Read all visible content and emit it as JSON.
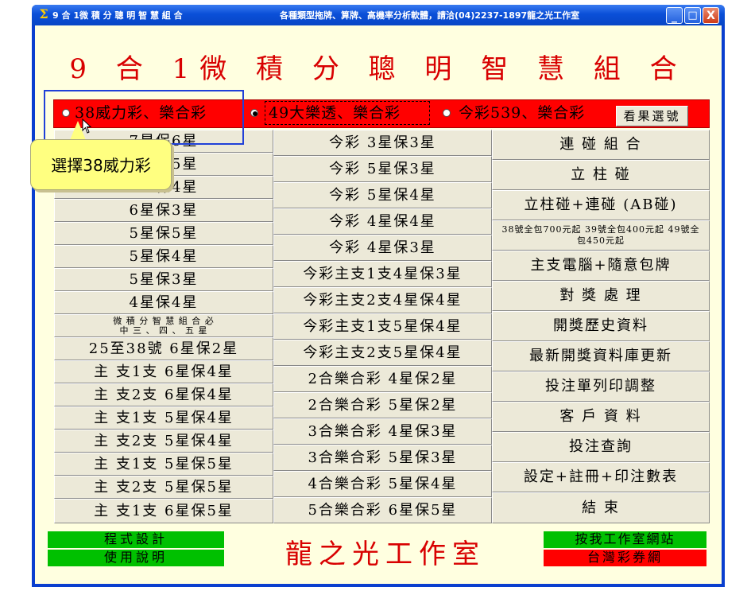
{
  "window": {
    "title": "9 合 1微 積 分 聰 明 智 慧 組 合",
    "notice": "各種類型拖牌、算牌、高機率分析軟體，請洽(04)2237-1897龍之光工作室",
    "minimize_glyph": "_",
    "maximize_glyph": "□",
    "close_glyph": "X",
    "app_icon": "sigma-icon",
    "app_icon_glyph": "Σ"
  },
  "main_title": "9 合 1微 積 分 聰 明 智 慧 組 合",
  "lottery": {
    "options": [
      {
        "label": "38威力彩、樂合彩",
        "selected": false
      },
      {
        "label": "49大樂透、樂合彩",
        "selected": true
      },
      {
        "label": "今彩539、樂合彩",
        "selected": false
      }
    ],
    "check_button": "看果選號"
  },
  "col1": [
    "7星保6星",
    "7星保5星",
    "6星保4星",
    "6星保3星",
    "5星保5星",
    "5星保4星",
    "5星保3星",
    "4星保4星",
    "微 積 分 智 慧 組 合 必 中 三 、 四 、 五 星",
    "25至38號  6星保2星",
    "主 支1支    6星保4星",
    "主 支2支    6星保4星",
    "主 支1支    5星保4星",
    "主 支2支    5星保4星",
    "主 支1支    5星保5星",
    "主 支2支    5星保5星",
    "主 支1支    6星保5星"
  ],
  "col2": [
    "今彩  3星保3星",
    "今彩  5星保3星",
    "今彩  5星保4星",
    "今彩  4星保4星",
    "今彩  4星保3星",
    "今彩主支1支4星保3星",
    "今彩主支2支4星保4星",
    "今彩主支1支5星保4星",
    "今彩主支2支5星保4星",
    "2合樂合彩    4星保2星",
    "2合樂合彩    5星保2星",
    "3合樂合彩    4星保3星",
    "3合樂合彩    5星保3星",
    "4合樂合彩    5星保4星",
    "5合樂合彩    6星保5星"
  ],
  "col3": [
    "連 碰 組 合",
    "立  柱  碰",
    "立柱碰+連碰 (AB碰)",
    "38號全包700元起  39號全包400元起 49號全包450元起",
    "主支電腦+隨意包牌",
    "對 獎 處 理",
    "開獎歷史資料",
    "最新開獎資料庫更新",
    "投注單列印調整",
    "客 戶 資 料",
    "投注查詢",
    "設定+註冊+印注數表",
    "結   束"
  ],
  "bottom": {
    "program_design": "程式設計",
    "usage_guide": "使用說明",
    "studio_name": "龍之光工作室",
    "studio_website": "按我工作室網站",
    "taiwan_lottery": "台灣彩券網"
  },
  "annotation": {
    "tooltip_text": "選擇38威力彩"
  },
  "colors": {
    "title_red": "#d80000",
    "bar_red": "#ff0000",
    "button_face": "#ece9d8",
    "client_bg": "#ffffe0",
    "green": "#00c000",
    "tooltip": "#ffff80",
    "highlight": "#2040d8"
  }
}
